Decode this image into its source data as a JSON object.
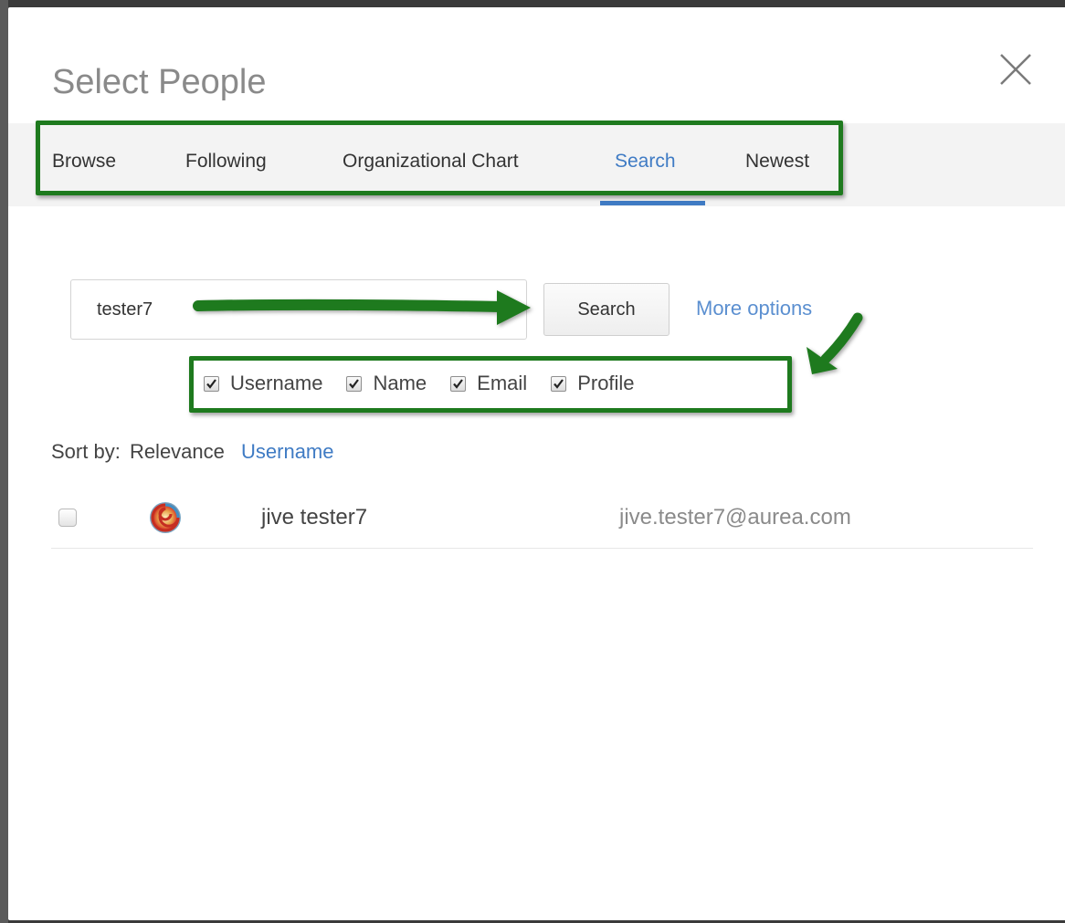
{
  "dialog": {
    "title": "Select People",
    "close_icon": "close-icon"
  },
  "tabs": [
    {
      "label": "Browse",
      "active": false
    },
    {
      "label": "Following",
      "active": false
    },
    {
      "label": "Organizational Chart",
      "active": false
    },
    {
      "label": "Search",
      "active": true
    },
    {
      "label": "Newest",
      "active": false
    }
  ],
  "search": {
    "value": "tester7",
    "button_label": "Search",
    "more_options_label": "More options"
  },
  "filters": [
    {
      "label": "Username",
      "checked": true
    },
    {
      "label": "Name",
      "checked": true
    },
    {
      "label": "Email",
      "checked": true
    },
    {
      "label": "Profile",
      "checked": true
    }
  ],
  "sort": {
    "label": "Sort by:",
    "current": "Relevance",
    "option": "Username"
  },
  "results": [
    {
      "name": "jive tester7",
      "email": "jive.tester7@aurea.com",
      "selected": false
    }
  ],
  "colors": {
    "accent": "#3f7bc4",
    "annotation": "#1e7a1e",
    "title": "#8a8a8a"
  }
}
